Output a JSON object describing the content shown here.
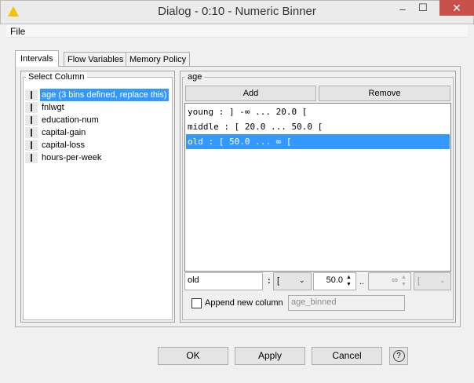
{
  "window": {
    "title": "Dialog - 0:10 - Numeric Binner",
    "minimize": "–",
    "maximize": "☐",
    "close": "✕"
  },
  "menu": {
    "file": "File"
  },
  "tabs": [
    {
      "label": "Intervals",
      "active": true
    },
    {
      "label": "Flow Variables"
    },
    {
      "label": "Memory Policy"
    }
  ],
  "select_column": {
    "legend": "Select Column",
    "items": [
      {
        "label": "age (3 bins defined, replace this)",
        "selected": true
      },
      {
        "label": "fnlwgt"
      },
      {
        "label": "education-num"
      },
      {
        "label": "capital-gain"
      },
      {
        "label": "capital-loss"
      },
      {
        "label": "hours-per-week"
      }
    ]
  },
  "bins": {
    "legend": "age",
    "add": "Add",
    "remove": "Remove",
    "intervals": [
      {
        "text": "young : ] -∞ ... 20.0 ["
      },
      {
        "text": "middle : [ 20.0 ... 50.0 ["
      },
      {
        "text": "old : [ 50.0 ... ∞ [",
        "selected": true
      }
    ]
  },
  "editor": {
    "name": "old",
    "colon": ":",
    "left_bracket": "[",
    "left_value": "50.0",
    "dots": "..",
    "right_value": "∞",
    "right_bracket": "["
  },
  "append": {
    "label": "Append new column",
    "checked": false,
    "column_name": "age_binned"
  },
  "footer": {
    "ok": "OK",
    "apply": "Apply",
    "cancel": "Cancel",
    "help": "?"
  },
  "colors": {
    "selection": "#3399ff",
    "close": "#c7504b"
  }
}
